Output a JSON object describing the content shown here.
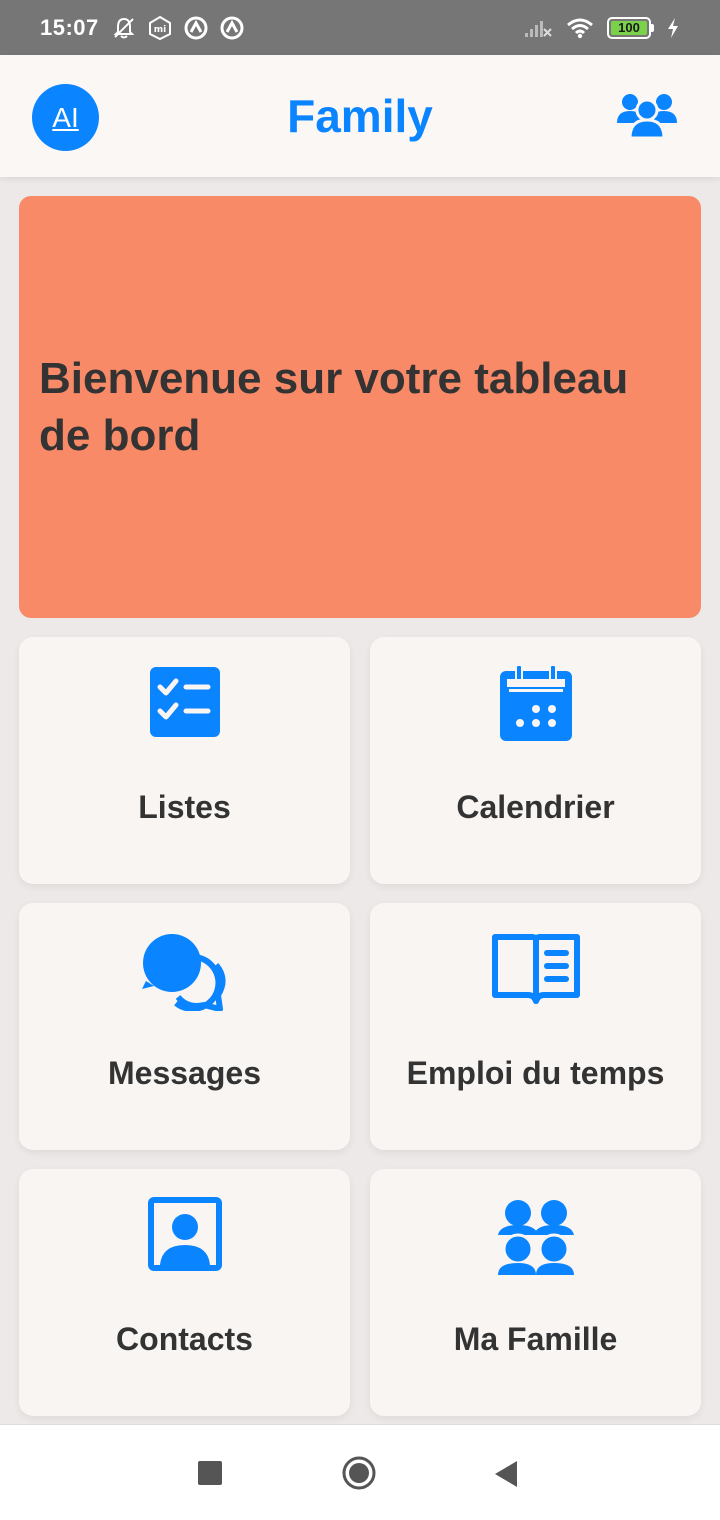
{
  "status_bar": {
    "time": "15:07",
    "left_icons": [
      "bell-off-icon",
      "mi-icon",
      "vpn-icon",
      "vpn-icon"
    ],
    "right_icons": [
      "signal-icon",
      "wifi-icon"
    ],
    "battery_level": "100"
  },
  "header": {
    "avatar_initials": "AI",
    "title": "Family",
    "family_icon": "family-icon"
  },
  "banner": {
    "text": "Bienvenue sur votre tableau de bord",
    "color": "#f98a68"
  },
  "tiles": [
    {
      "label": "Listes",
      "icon": "checklist-icon"
    },
    {
      "label": "Calendrier",
      "icon": "calendar-icon"
    },
    {
      "label": "Messages",
      "icon": "chat-icon"
    },
    {
      "label": "Emploi du temps",
      "icon": "book-icon"
    },
    {
      "label": "Contacts",
      "icon": "contact-icon"
    },
    {
      "label": "Ma Famille",
      "icon": "family-icon"
    }
  ],
  "nav": [
    "recents-button",
    "home-button",
    "back-button"
  ],
  "colors": {
    "accent": "#0a84ff",
    "text": "#333333",
    "status_bar": "#767676"
  }
}
